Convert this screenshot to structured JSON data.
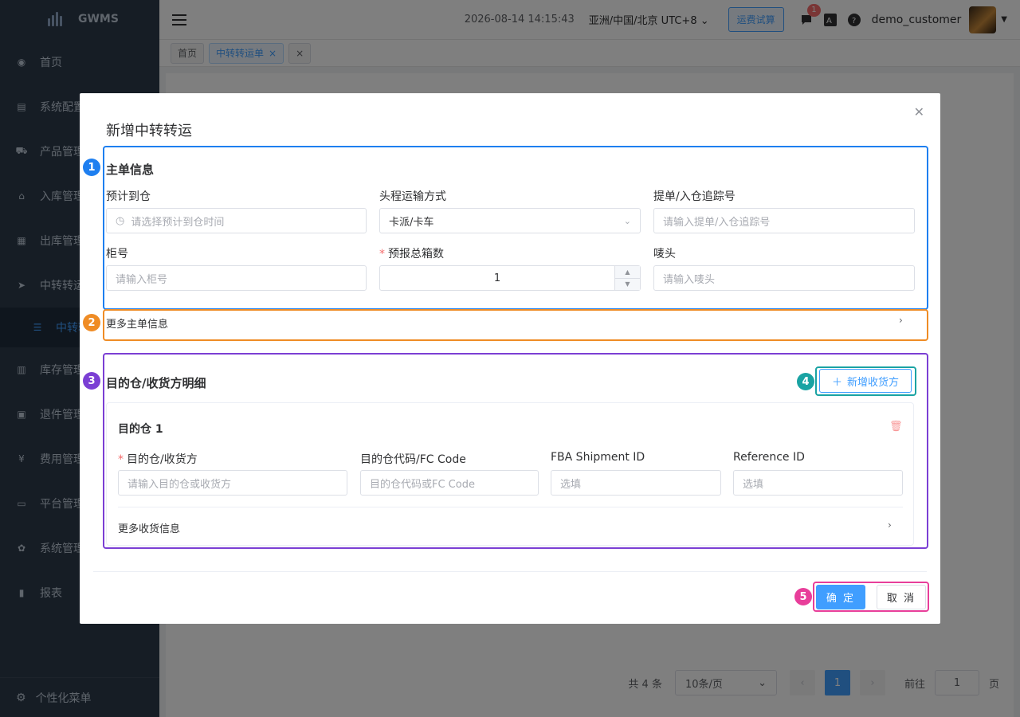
{
  "app": {
    "logo_text": "GWMS"
  },
  "sidebar": {
    "items": [
      {
        "label": "首页",
        "icon": "dashboard-icon"
      },
      {
        "label": "系统配置",
        "icon": "config-icon"
      },
      {
        "label": "产品管理",
        "icon": "cart-icon"
      },
      {
        "label": "入库管理",
        "icon": "home-icon"
      },
      {
        "label": "出库管理",
        "icon": "grid-icon"
      },
      {
        "label": "中转转运",
        "icon": "send-icon"
      },
      {
        "label": "中转转运单",
        "icon": "list-icon"
      },
      {
        "label": "库存管理",
        "icon": "inventory-icon"
      },
      {
        "label": "退件管理",
        "icon": "return-icon"
      },
      {
        "label": "费用管理",
        "icon": "yen-icon"
      },
      {
        "label": "平台管理",
        "icon": "platform-icon"
      },
      {
        "label": "系统管理",
        "icon": "gear-icon"
      },
      {
        "label": "报表",
        "icon": "chart-icon"
      }
    ],
    "bottom_label": "个性化菜单"
  },
  "header": {
    "datetime": "2026-08-14 14:15:43",
    "timezone": "亚洲/中国/北京 UTC+8",
    "calc_button": "运费试算",
    "message_count": "1",
    "username": "demo_customer"
  },
  "tabs": [
    {
      "label": "首页"
    },
    {
      "label": "中转转运单"
    }
  ],
  "pagination": {
    "total": "共 4 条",
    "page_size": "10条/页",
    "current_page": "1",
    "goto_label": "前往",
    "goto_value": "1",
    "page_suffix": "页"
  },
  "dialog": {
    "title": "新增中转转运",
    "main_section": {
      "badge": "1",
      "title": "主单信息",
      "fields": {
        "eta_label": "预计到仓",
        "eta_placeholder": "请选择预计到仓时间",
        "transport_label": "头程运输方式",
        "transport_value": "卡派/卡车",
        "tracking_label": "提单/入仓追踪号",
        "tracking_placeholder": "请输入提单/入仓追踪号",
        "container_label": "柜号",
        "container_placeholder": "请输入柜号",
        "boxes_required": "*",
        "boxes_label": "预报总箱数",
        "boxes_value": "1",
        "mark_label": "唛头",
        "mark_placeholder": "请输入唛头"
      }
    },
    "more_main": {
      "badge": "2",
      "label": "更多主单信息"
    },
    "dest_section": {
      "badge": "3",
      "title": "目的仓/收货方明细",
      "add_badge": "4",
      "add_button": "新增收货方",
      "card": {
        "title": "目的仓 1",
        "dest_required": "*",
        "dest_label": "目的仓/收货方",
        "dest_placeholder": "请输入目的仓或收货方",
        "fc_label": "目的仓代码/FC Code",
        "fc_placeholder": "目的仓代码或FC Code",
        "fba_label": "FBA Shipment ID",
        "fba_placeholder": "选填",
        "ref_label": "Reference ID",
        "ref_placeholder": "选填",
        "more_label": "更多收货信息"
      }
    },
    "footer": {
      "badge": "5",
      "confirm": "确 定",
      "cancel": "取 消"
    }
  },
  "colors": {
    "primary": "#409eff",
    "box1": "#1e7ff0",
    "box2": "#ef8c25",
    "box3": "#7b3fd4",
    "box4": "#1aa3a3",
    "box5": "#e83e9a"
  }
}
